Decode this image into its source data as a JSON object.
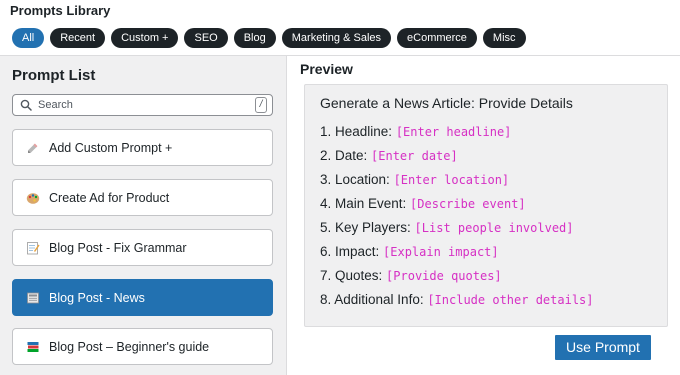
{
  "app": {
    "title": "Prompts Library"
  },
  "tabs": [
    {
      "label": "All",
      "active": true
    },
    {
      "label": "Recent"
    },
    {
      "label": "Custom +"
    },
    {
      "label": "SEO"
    },
    {
      "label": "Blog"
    },
    {
      "label": "Marketing & Sales"
    },
    {
      "label": "eCommerce"
    },
    {
      "label": "Misc"
    }
  ],
  "sidebar": {
    "title": "Prompt List",
    "search": {
      "placeholder": "Search",
      "value": "",
      "shortcut": "/"
    },
    "items": [
      {
        "label": "Add Custom Prompt +",
        "icon": "pencil-icon"
      },
      {
        "label": "Create Ad for Product",
        "icon": "palette-icon"
      },
      {
        "label": "Blog Post - Fix Grammar",
        "icon": "memo-icon"
      },
      {
        "label": "Blog Post - News",
        "icon": "newspaper-icon",
        "active": true
      },
      {
        "label": "Blog Post – Beginner's guide",
        "icon": "books-icon"
      }
    ]
  },
  "preview": {
    "title": "Preview",
    "heading": "Generate a News Article: Provide Details",
    "lines": [
      {
        "text": "1. Headline: ",
        "placeholder": "[Enter headline]"
      },
      {
        "text": "2. Date: ",
        "placeholder": "[Enter date]"
      },
      {
        "text": "3. Location: ",
        "placeholder": "[Enter location]"
      },
      {
        "text": "4. Main Event: ",
        "placeholder": "[Describe event]"
      },
      {
        "text": "5. Key Players: ",
        "placeholder": "[List people involved]"
      },
      {
        "text": "6. Impact: ",
        "placeholder": "[Explain impact]"
      },
      {
        "text": "7. Quotes: ",
        "placeholder": "[Provide quotes]"
      },
      {
        "text": "8. Additional Info: ",
        "placeholder": "[Include other details]"
      }
    ]
  },
  "actions": {
    "use_prompt": "Use Prompt"
  },
  "colors": {
    "accent": "#2271b1",
    "tab_dark": "#1d2327",
    "placeholder": "#d630c4",
    "panel_bg": "#f0f0f1"
  }
}
